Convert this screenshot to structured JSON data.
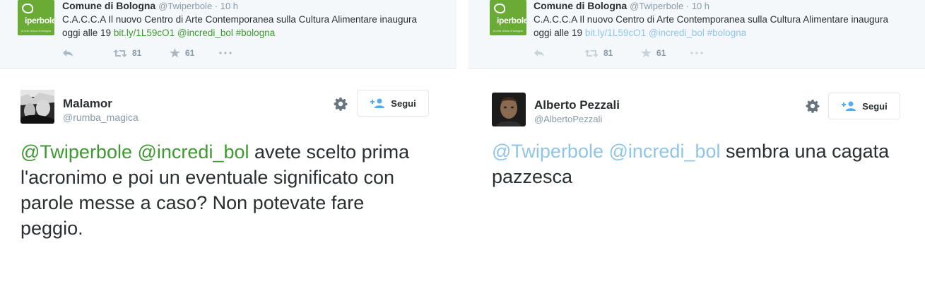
{
  "colors": {
    "mention_green": "#3c9a2f",
    "mention_blue_faded": "#8fc6e8",
    "context_bg": "#f5f8fa",
    "text": "#292f33",
    "muted": "#8899a6",
    "brand_green": "#6aab35"
  },
  "panels": [
    {
      "context": {
        "avatar_icon": "iperbole-logo-icon",
        "avatar_text": "iperbole",
        "avatar_subtext": "la rete civica di bologna",
        "name": "Comune di Bologna",
        "meta": "@Twiperbole · 10 h",
        "text_pre": "C.A.C.C.A Il nuovo Centro di Arte Contemporanea sulla Cultura Alimentare inaugura oggi alle 19 ",
        "link": "bit.ly/1L59cO1",
        "mention": "@incredi_bol",
        "hashtag": "#bologna",
        "retweets": "81",
        "favorites": "61"
      },
      "author": {
        "name": "Malamor",
        "handle": "@rumba_magica",
        "follow_label": "Segui"
      },
      "tweet": {
        "mention1": "@Twiperbole",
        "mention2": "@incredi_bol",
        "text": " avete scelto prima l'acronimo e poi un eventuale significato con parole messe a caso? Non potevate fare peggio."
      }
    },
    {
      "context": {
        "avatar_icon": "iperbole-logo-icon",
        "avatar_text": "iperbole",
        "avatar_subtext": "la rete civica di bologna",
        "name": "Comune di Bologna",
        "meta": "@Twiperbole · 10 h",
        "text_pre": "C.A.C.C.A Il nuovo Centro di Arte Contemporanea sulla Cultura Alimentare inaugura oggi alle 19 ",
        "link": "bit.ly/1L59cO1",
        "mention": "@incredi_bol",
        "hashtag": "#bologna",
        "retweets": "81",
        "favorites": "61"
      },
      "author": {
        "name": "Alberto Pezzali",
        "handle": "@AlbertoPezzali",
        "follow_label": "Segui"
      },
      "tweet": {
        "mention1": "@Twiperbole",
        "mention2": "@incredi_bol",
        "text": " sembra una cagata pazzesca"
      }
    }
  ]
}
